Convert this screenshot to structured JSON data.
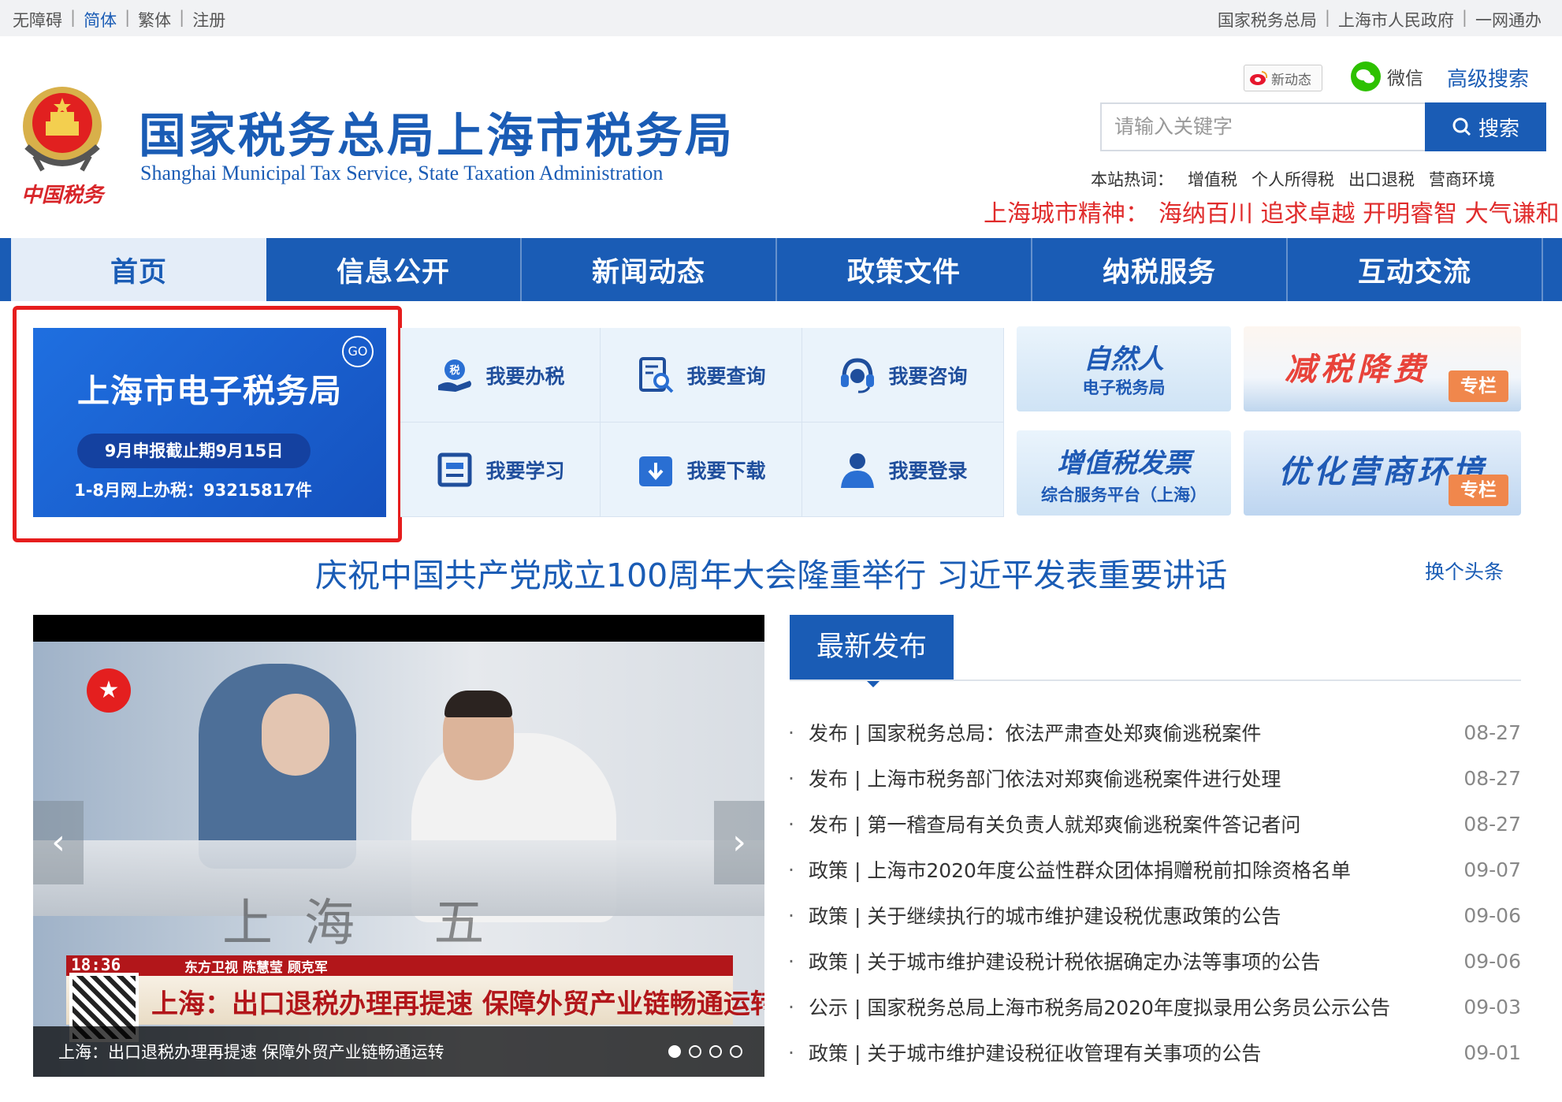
{
  "topbar": {
    "left": [
      {
        "label": "无障碍",
        "active": false
      },
      {
        "label": "简体",
        "active": true
      },
      {
        "label": "繁体",
        "active": false
      },
      {
        "label": "注册",
        "active": false
      }
    ],
    "right": [
      "国家税务总局",
      "上海市人民政府",
      "一网通办"
    ],
    "separator": "|"
  },
  "header": {
    "title": "国家税务总局上海市税务局",
    "subtitle": "Shanghai Municipal Tax Service, State Taxation Administration",
    "emblem_caption": "中国税务",
    "weibo_label": "新动态",
    "wechat_label": "微信",
    "advanced_search": "高级搜索",
    "search_placeholder": "请输入关键字",
    "search_button": "搜索",
    "hotwords_label": "本站热词：",
    "hotwords": [
      "增值税",
      "个人所得税",
      "出口退税",
      "营商环境"
    ],
    "spirit_label": "上海城市精神：",
    "spirit_text": "海纳百川 追求卓越 开明睿智 大气谦和"
  },
  "nav": [
    {
      "label": "首页",
      "active": true
    },
    {
      "label": "信息公开",
      "active": false
    },
    {
      "label": "新闻动态",
      "active": false
    },
    {
      "label": "政策文件",
      "active": false
    },
    {
      "label": "纳税服务",
      "active": false
    },
    {
      "label": "互动交流",
      "active": false
    }
  ],
  "etax": {
    "title": "上海市电子税务局",
    "go": "GO",
    "deadline": "9月申报截止期9月15日",
    "count": "1-8月网上办税：93215817件"
  },
  "services": [
    {
      "label": "我要办税",
      "icon": "hand-tax-icon"
    },
    {
      "label": "我要查询",
      "icon": "search-doc-icon"
    },
    {
      "label": "我要咨询",
      "icon": "headset-icon"
    },
    {
      "label": "我要学习",
      "icon": "book-icon"
    },
    {
      "label": "我要下载",
      "icon": "download-icon"
    },
    {
      "label": "我要登录",
      "icon": "user-icon"
    }
  ],
  "banners": {
    "natural": {
      "title": "自然人",
      "sub": "电子税务局"
    },
    "tax_cut": {
      "title": "减税降费",
      "tag": "专栏"
    },
    "vat": {
      "title": "增值税发票",
      "sub": "综合服务平台（上海）"
    },
    "business": {
      "title": "优化营商环境",
      "tag": "专栏"
    }
  },
  "headline": {
    "text": "庆祝中国共产党成立100周年大会隆重举行 习近平发表重要讲话",
    "swap": "换个头条"
  },
  "carousel": {
    "time": "18:36",
    "channel": "东方卫视 陈慧莹 顾克军",
    "news_title": "上海：出口退税办理再提速 保障外贸产业链畅通运转",
    "sign_text": "上海 五",
    "caption": "上海：出口退税办理再提速 保障外贸产业链畅通运转",
    "slides": 4,
    "current_slide": 1
  },
  "latest": {
    "tab": "最新发布",
    "items": [
      {
        "cat": "发布",
        "title": "国家税务总局：依法严肃查处郑爽偷逃税案件",
        "date": "08-27"
      },
      {
        "cat": "发布",
        "title": "上海市税务部门依法对郑爽偷逃税案件进行处理",
        "date": "08-27"
      },
      {
        "cat": "发布",
        "title": "第一稽查局有关负责人就郑爽偷逃税案件答记者问",
        "date": "08-27"
      },
      {
        "cat": "政策",
        "title": "上海市2020年度公益性群众团体捐赠税前扣除资格名单",
        "date": "09-07"
      },
      {
        "cat": "政策",
        "title": "关于继续执行的城市维护建设税优惠政策的公告",
        "date": "09-06"
      },
      {
        "cat": "政策",
        "title": "关于城市维护建设税计税依据确定办法等事项的公告",
        "date": "09-06"
      },
      {
        "cat": "公示",
        "title": "国家税务总局上海市税务局2020年度拟录用公务员公示公告",
        "date": "09-03"
      },
      {
        "cat": "政策",
        "title": "关于城市维护建设税征收管理有关事项的公告",
        "date": "09-01"
      }
    ]
  },
  "colors": {
    "brand_blue": "#1a5cb5",
    "alert_red": "#e61d1d",
    "orange_tag": "#f0874c"
  }
}
